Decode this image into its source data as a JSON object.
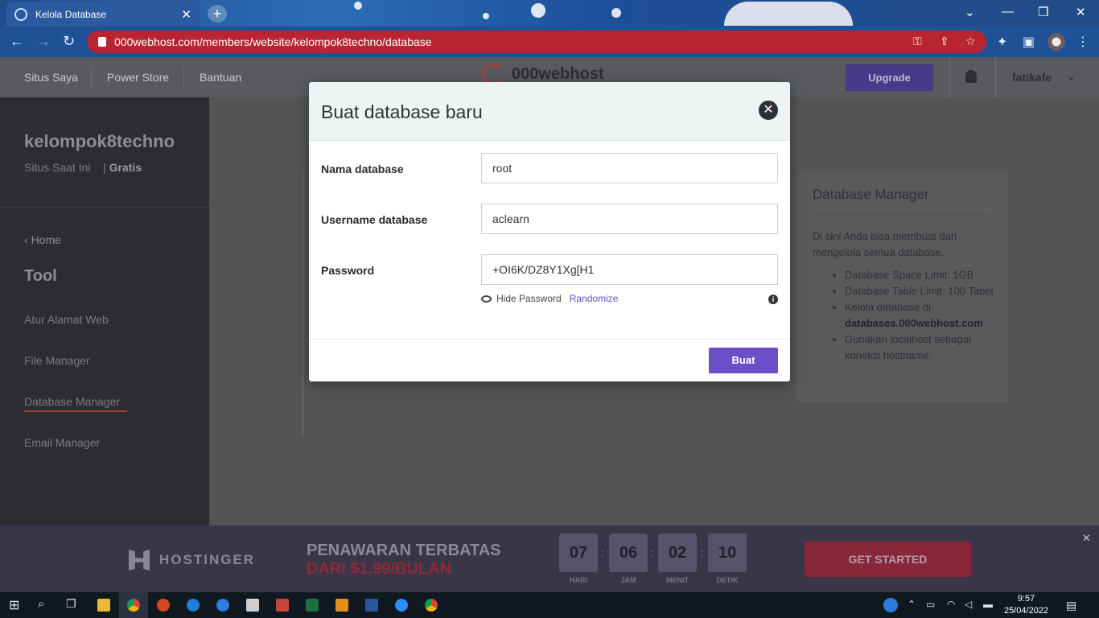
{
  "browser": {
    "tab_title": "Kelola Database",
    "url": "000webhost.com/members/website/kelompok8techno/database",
    "window_controls": [
      "chevron-down-icon",
      "minimize-icon",
      "restore-icon",
      "close-icon"
    ]
  },
  "site_header": {
    "nav": [
      "Situs Saya",
      "Power Store",
      "Bantuan"
    ],
    "logo_text": "000webhost",
    "upgrade_label": "Upgrade",
    "username": "fatikafe"
  },
  "sidebar": {
    "site_name": "kelompok8techno",
    "site_status": "Situs Saat Ini",
    "plan": "Gratis",
    "home_label": "Home",
    "tool_heading": "Tool",
    "items": [
      "Atur Alamat Web",
      "File Manager",
      "Database Manager",
      "Email Manager"
    ],
    "active_item": "Database Manager"
  },
  "info_panel": {
    "title": "Database Manager",
    "description": "Di sini Anda bisa membuat dan mengelola semua database.",
    "bullets": [
      {
        "text": "Database Space Limit: 1GB"
      },
      {
        "text": "Database Table Limit: 100 Tabel"
      },
      {
        "prefix": "Kelola database di",
        "bold": "databases.000webhost.com"
      },
      {
        "text": "Gunakan localhost sebagai koneksi hostname."
      }
    ]
  },
  "modal": {
    "title": "Buat database baru",
    "fields": [
      {
        "label": "Nama database",
        "value": "root"
      },
      {
        "label": "Username database",
        "value": "aclearn"
      },
      {
        "label": "Password",
        "value": "+OI6K/DZ8Y1Xg[H1"
      }
    ],
    "hide_password_label": "Hide Password",
    "randomize_label": "Randomize",
    "submit_label": "Buat"
  },
  "promo": {
    "brand": "HOSTINGER",
    "headline": "PENAWARAN TERBATAS",
    "subline": "DARI $1.99/BULAN",
    "countdown": [
      {
        "value": "07",
        "label": "HARI"
      },
      {
        "value": "06",
        "label": "JAM"
      },
      {
        "value": "02",
        "label": "MENIT"
      },
      {
        "value": "10",
        "label": "DETIK"
      }
    ],
    "cta": "GET STARTED"
  },
  "taskbar": {
    "time": "9:57",
    "date": "25/04/2022"
  },
  "colors": {
    "accent": "#6b4fc8",
    "omnibox": "#b8242f",
    "promo_cta": "#86283a"
  }
}
